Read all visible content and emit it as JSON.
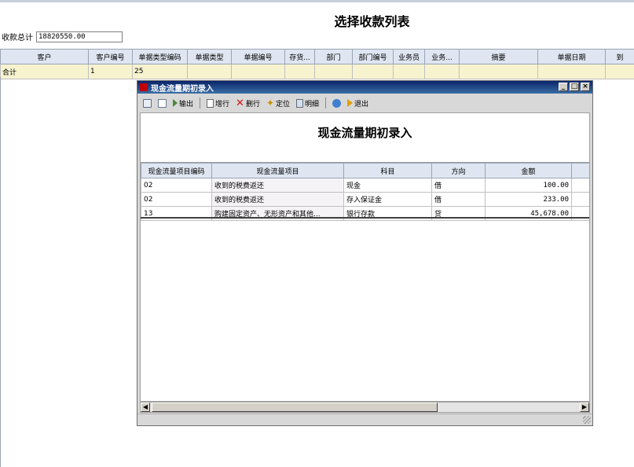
{
  "page": {
    "title": "选择收款列表",
    "total_label": "收款总计",
    "total_value": "18820550.00"
  },
  "main_grid": {
    "columns": [
      "客户",
      "客户编号",
      "单据类型编码",
      "单据类型",
      "单据编号",
      "存货...",
      "部门",
      "部门编号",
      "业务员",
      "业务...",
      "摘要",
      "单据日期",
      "到"
    ],
    "total_row": [
      "合计",
      "1",
      "25",
      "",
      "",
      "",
      "",
      "",
      "",
      "",
      "",
      "",
      ""
    ]
  },
  "dialog": {
    "title": "现金流量期初录入",
    "window_buttons": [
      "_",
      "□",
      "×"
    ],
    "toolbar": {
      "print_icon": "print-icon",
      "preview_icon": "preview-icon",
      "output": "输出",
      "add_row": "增行",
      "delete_row": "删行",
      "locate": "定位",
      "detail": "明细",
      "exit": "退出"
    },
    "report_title": "现金流量期初录入",
    "columns": [
      "现金流量项目编码",
      "现金流量项目",
      "科目",
      "方向",
      "金额"
    ],
    "rows": [
      {
        "code": "02",
        "item": "收到的税费返还",
        "account": "现金",
        "direction": "借",
        "amount": "100.00"
      },
      {
        "code": "02",
        "item": "收到的税费返还",
        "account": "存入保证金",
        "direction": "借",
        "amount": "233.00"
      },
      {
        "code": "13",
        "item": "购建固定资产、无形资产和其他...",
        "account": "银行存款",
        "direction": "贷",
        "amount": "45,678.00"
      }
    ],
    "scrollbar": {
      "left_arrow": "◀",
      "right_arrow": "▶"
    }
  }
}
